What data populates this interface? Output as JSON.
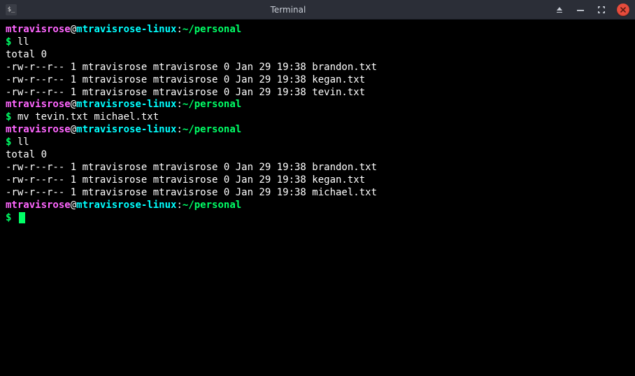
{
  "window": {
    "title": "Terminal",
    "icon_label": "$_"
  },
  "colors": {
    "prompt_user": "#ff66ff",
    "prompt_host": "#00ffff",
    "prompt_path": "#00ff66",
    "cursor": "#00ff66",
    "bg": "#000000",
    "titlebar": "#2b2e37",
    "close": "#e74c3c"
  },
  "prompt": {
    "user": "mtravisrose",
    "at": "@",
    "host": "mtravisrose-linux",
    "colon": ":",
    "path": "~/personal",
    "dollar": "$ "
  },
  "session": [
    {
      "type": "prompt"
    },
    {
      "type": "cmd",
      "text": "ll"
    },
    {
      "type": "out",
      "text": "total 0"
    },
    {
      "type": "out",
      "text": "-rw-r--r-- 1 mtravisrose mtravisrose 0 Jan 29 19:38 brandon.txt"
    },
    {
      "type": "out",
      "text": "-rw-r--r-- 1 mtravisrose mtravisrose 0 Jan 29 19:38 kegan.txt"
    },
    {
      "type": "out",
      "text": "-rw-r--r-- 1 mtravisrose mtravisrose 0 Jan 29 19:38 tevin.txt"
    },
    {
      "type": "prompt"
    },
    {
      "type": "cmd",
      "text": "mv tevin.txt michael.txt"
    },
    {
      "type": "prompt"
    },
    {
      "type": "cmd",
      "text": "ll"
    },
    {
      "type": "out",
      "text": "total 0"
    },
    {
      "type": "out",
      "text": "-rw-r--r-- 1 mtravisrose mtravisrose 0 Jan 29 19:38 brandon.txt"
    },
    {
      "type": "out",
      "text": "-rw-r--r-- 1 mtravisrose mtravisrose 0 Jan 29 19:38 kegan.txt"
    },
    {
      "type": "out",
      "text": "-rw-r--r-- 1 mtravisrose mtravisrose 0 Jan 29 19:38 michael.txt"
    },
    {
      "type": "prompt"
    },
    {
      "type": "cursor"
    }
  ]
}
